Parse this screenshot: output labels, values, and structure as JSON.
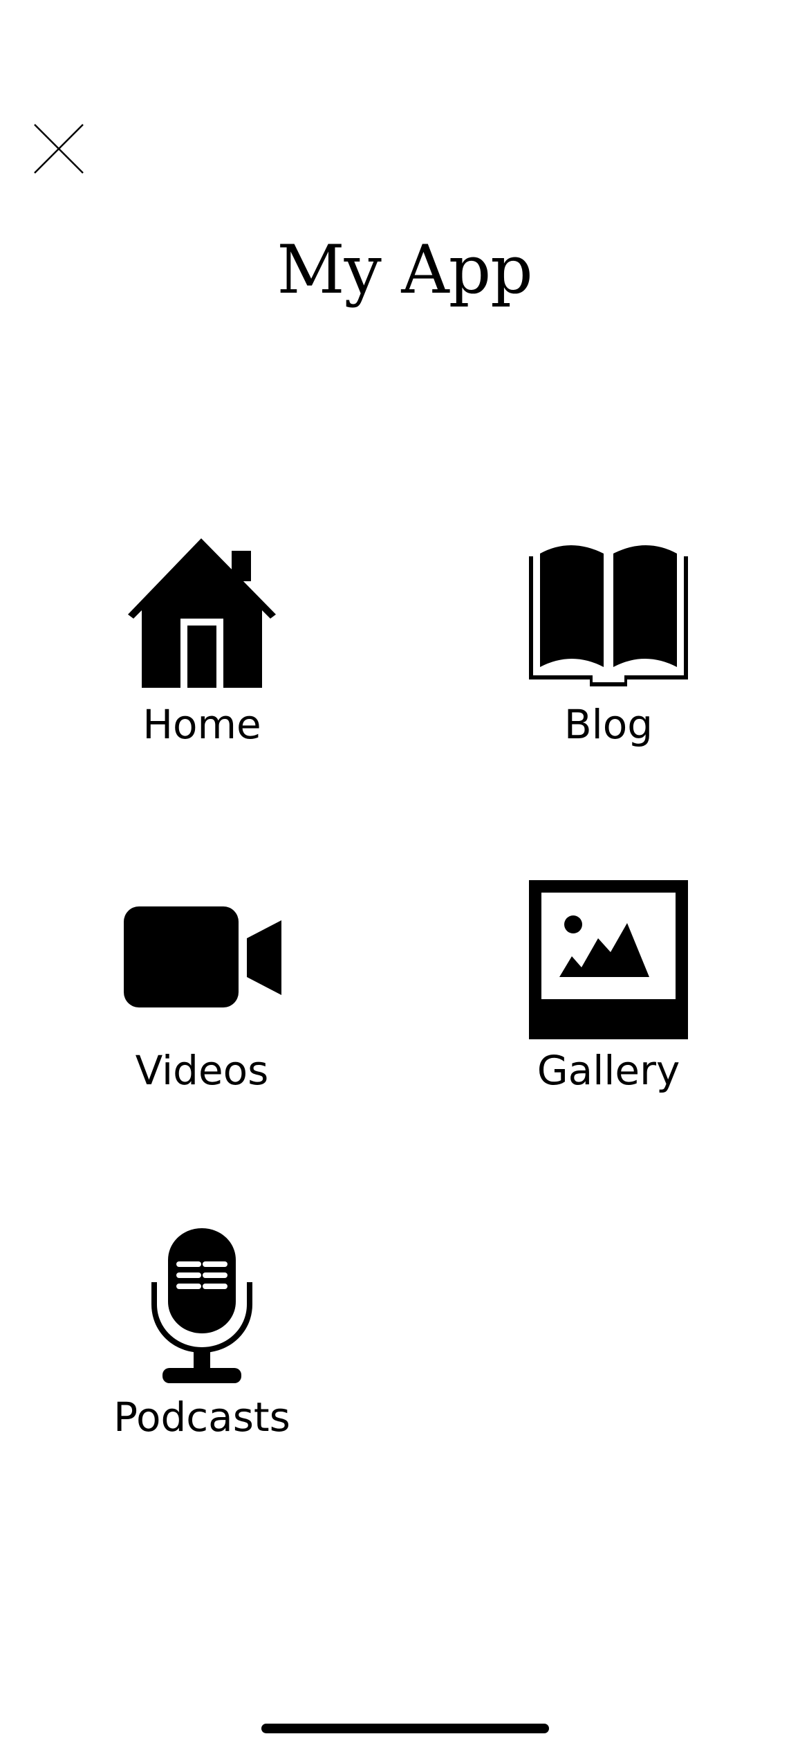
{
  "header": {
    "title": "My App",
    "close_icon": "close-icon"
  },
  "menu": {
    "items": [
      {
        "label": "Home",
        "icon": "house-icon"
      },
      {
        "label": "Blog",
        "icon": "open-book-icon"
      },
      {
        "label": "Videos",
        "icon": "video-camera-icon"
      },
      {
        "label": "Gallery",
        "icon": "photo-icon"
      },
      {
        "label": "Podcasts",
        "icon": "microphone-icon"
      }
    ]
  },
  "colors": {
    "background": "#ffffff",
    "foreground": "#000000"
  }
}
